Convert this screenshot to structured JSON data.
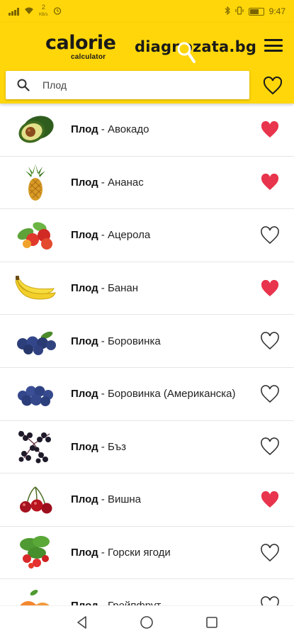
{
  "status_bar": {
    "time": "9:47",
    "icons": [
      "signal-icon",
      "wifi-icon",
      "usb-icon",
      "alarm-icon",
      "bluetooth-icon",
      "vibrate-icon",
      "battery-icon"
    ],
    "small_text": "KB/s"
  },
  "header": {
    "logo_main": "calorie",
    "logo_sub": "calculator",
    "brand": "diagnozata.bg",
    "accent_color": "#FFD60A"
  },
  "search": {
    "placeholder": "Плод",
    "value": ""
  },
  "list": {
    "items": [
      {
        "category": "Плод",
        "name": "Авокадо",
        "favorite": true,
        "image": "avocado"
      },
      {
        "category": "Плод",
        "name": "Ананас",
        "favorite": true,
        "image": "pineapple"
      },
      {
        "category": "Плод",
        "name": "Ацерола",
        "favorite": false,
        "image": "acerola"
      },
      {
        "category": "Плод",
        "name": "Банан",
        "favorite": true,
        "image": "banana"
      },
      {
        "category": "Плод",
        "name": "Боровинка",
        "favorite": false,
        "image": "blueberry"
      },
      {
        "category": "Плод",
        "name": "Боровинка (Американска)",
        "favorite": false,
        "image": "blueberry-american"
      },
      {
        "category": "Плод",
        "name": "Бъз",
        "favorite": false,
        "image": "elderberry"
      },
      {
        "category": "Плод",
        "name": "Вишна",
        "favorite": true,
        "image": "cherry"
      },
      {
        "category": "Плод",
        "name": "Горски ягоди",
        "favorite": false,
        "image": "wild-strawberry"
      },
      {
        "category": "Плод",
        "name": "Грейпфрут",
        "favorite": false,
        "image": "grapefruit"
      }
    ],
    "separator": " - ",
    "heart_color": "#E8344C"
  },
  "nav": {
    "icons": [
      "back-icon",
      "home-icon",
      "recents-icon"
    ]
  }
}
